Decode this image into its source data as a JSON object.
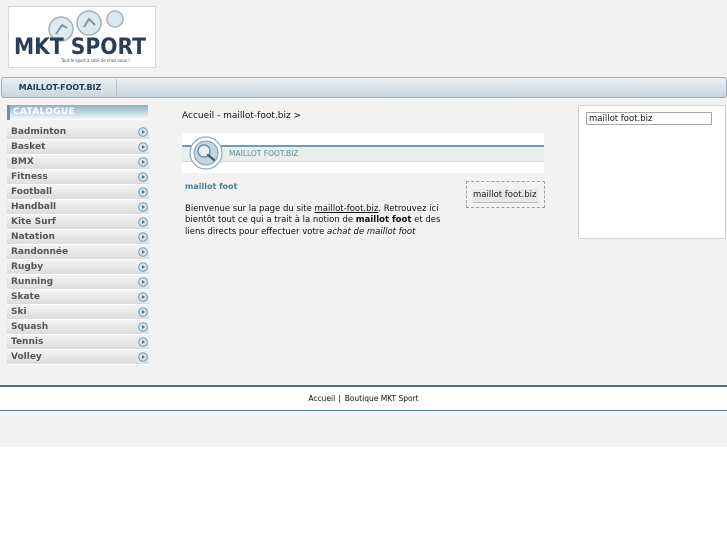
{
  "header": {
    "logo": {
      "brand": "MKT SPORT",
      "tagline": "Tout le sport à côté de chez vous !"
    }
  },
  "topnav": {
    "tab_label": "MAILLOT-FOOT.BIZ"
  },
  "sidebar": {
    "heading": "CATALOGUE",
    "items": [
      {
        "label": "Badminton"
      },
      {
        "label": "Basket"
      },
      {
        "label": "BMX"
      },
      {
        "label": "Fitness"
      },
      {
        "label": "Football"
      },
      {
        "label": "Handball"
      },
      {
        "label": "Kite Surf"
      },
      {
        "label": "Natation"
      },
      {
        "label": "Randonnée"
      },
      {
        "label": "Rugby"
      },
      {
        "label": "Running"
      },
      {
        "label": "Skate"
      },
      {
        "label": "Ski"
      },
      {
        "label": "Squash"
      },
      {
        "label": "Tennis"
      },
      {
        "label": "Volley"
      }
    ]
  },
  "main": {
    "breadcrumb": "Accueil - maillot-foot.biz >",
    "banner_title": "MAILLOT FOOT.BIZ",
    "section_title": "maillot foot",
    "paragraph": {
      "intro": "Bienvenue sur la page du site ",
      "site_link": "maillot-foot.biz",
      "mid": ". Retrouvez ici bientôt tout ce qui a trait à la notion de ",
      "keyword": "maillot foot",
      "mid2": " et des liens directs pour effectuer votre ",
      "action": "achat de maillot foot"
    },
    "tag_box": "maillot foot.biz"
  },
  "right_panel": {
    "search_value": "maillot foot.biz"
  },
  "footer": {
    "home_link": "Accueil",
    "separator": "|",
    "shop_link": "Boutique MKT Sport"
  },
  "colors": {
    "accent": "#4d7c95",
    "nav_text": "#1f3a55",
    "footer_line": "#4d6e86"
  }
}
